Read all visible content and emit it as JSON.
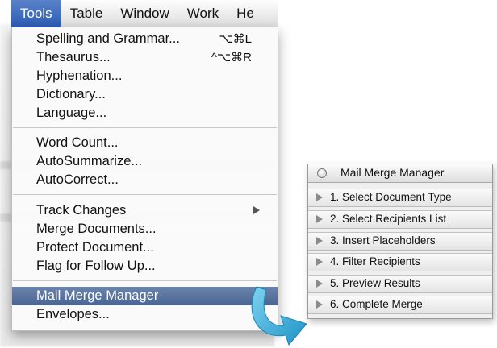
{
  "menubar": {
    "items": [
      {
        "label": "Tools",
        "active": true
      },
      {
        "label": "Table"
      },
      {
        "label": "Window"
      },
      {
        "label": "Work"
      },
      {
        "label": "He"
      }
    ]
  },
  "tools_menu": {
    "group1": [
      {
        "label": "Spelling and Grammar...",
        "shortcut": "⌥⌘L"
      },
      {
        "label": "Thesaurus...",
        "shortcut": "^⌥⌘R"
      },
      {
        "label": "Hyphenation..."
      },
      {
        "label": "Dictionary..."
      },
      {
        "label": "Language..."
      }
    ],
    "group2": [
      {
        "label": "Word Count..."
      },
      {
        "label": "AutoSummarize..."
      },
      {
        "label": "AutoCorrect..."
      }
    ],
    "group3": [
      {
        "label": "Track Changes",
        "submenu": true
      },
      {
        "label": "Merge Documents..."
      },
      {
        "label": "Protect Document..."
      },
      {
        "label": "Flag for Follow Up..."
      }
    ],
    "group4": [
      {
        "label": "Mail Merge Manager",
        "highlighted": true
      },
      {
        "label": "Envelopes..."
      }
    ]
  },
  "palette": {
    "title": "Mail Merge Manager",
    "steps": [
      "1. Select Document Type",
      "2. Select Recipients List",
      "3. Insert Placeholders",
      "4. Filter Recipients",
      "5. Preview Results",
      "6. Complete Merge"
    ]
  },
  "colors": {
    "menu_highlight": "#5a7399",
    "menubar_active": "#3a66bb",
    "arrow": "#2aa7d6"
  },
  "icons": {
    "submenu": "chevron-right-icon",
    "disclosure": "disclosure-triangle-icon",
    "window_control": "circle-icon",
    "curved_arrow": "curved-arrow-icon"
  }
}
